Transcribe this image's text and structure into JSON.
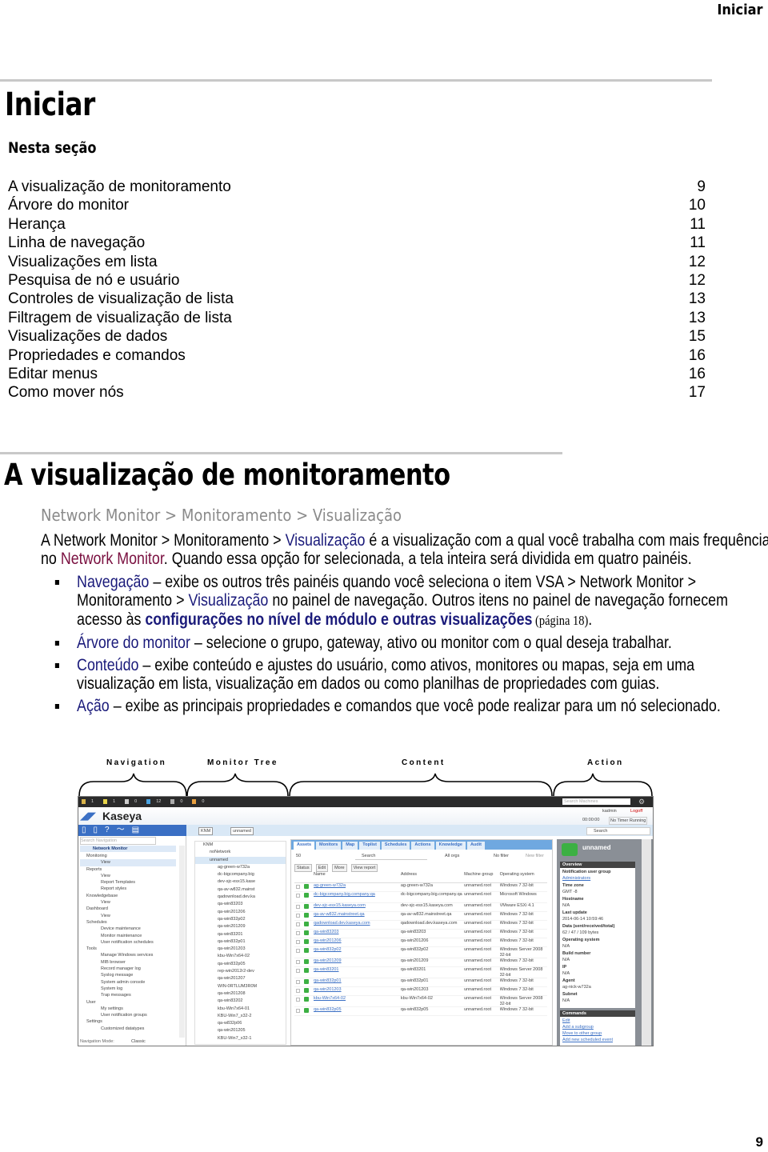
{
  "header": {
    "running_title": "Iniciar"
  },
  "title": "Iniciar",
  "section_heading": "Nesta seção",
  "toc": [
    {
      "label": "A visualização de monitoramento",
      "page": "9"
    },
    {
      "label": "Árvore do monitor",
      "page": "10"
    },
    {
      "label": "Herança",
      "page": "11"
    },
    {
      "label": "Linha de navegação",
      "page": "11"
    },
    {
      "label": "Visualizações em lista",
      "page": "12"
    },
    {
      "label": "Pesquisa de nó e usuário",
      "page": "12"
    },
    {
      "label": "Controles de visualização de lista",
      "page": "13"
    },
    {
      "label": "Filtragem de visualização de lista",
      "page": "13"
    },
    {
      "label": "Visualizações de dados",
      "page": "15"
    },
    {
      "label": "Propriedades e comandos",
      "page": "16"
    },
    {
      "label": "Editar menus",
      "page": "16"
    },
    {
      "label": "Como mover nós",
      "page": "17"
    }
  ],
  "section2": {
    "title": "A visualização de monitoramento",
    "breadcrumb": "Network Monitor  >  Monitoramento  >  Visualização",
    "intro": {
      "p1": "A Network Monitor > Monitoramento > ",
      "link1": "Visualização",
      "p2": " é a visualização com a qual você trabalha com mais frequência no ",
      "link2": "Network Monitor",
      "p3": ". Quando essa opção for selecionada, a tela inteira será dividida em quatro painéis."
    },
    "bullets": [
      {
        "term": "Navegação",
        "a": " – exibe os outros três painéis quando você seleciona o item VSA > Network Monitor > Monitoramento > ",
        "link": "Visualização",
        "b": " no painel de navegação.   Outros itens no painel de navegação fornecem acesso às ",
        "link2": "configurações no nível de módulo e outras visualizações",
        "ref": " (página 18)",
        "end": "."
      },
      {
        "term": "Árvore do monitor",
        "a": " – selecione o grupo, gateway, ativo ou monitor com o qual deseja trabalhar."
      },
      {
        "term": "Conteúdo",
        "a": " – exibe conteúdo e ajustes do usuário, como ativos, monitores ou mapas, seja em uma visualização em lista, visualização em dados ou como planilhas de propriedades com guias."
      },
      {
        "term": "Ação",
        "a": " – exibe as principais propriedades e comandos que você pode realizar para um nó selecionado."
      }
    ]
  },
  "figure": {
    "panel_labels": [
      "Navigation",
      "Monitor Tree",
      "Content",
      "Action"
    ],
    "topbar_counts": [
      "1",
      "1",
      "0",
      "12",
      "0",
      "0"
    ],
    "search_machines": "Search Machines",
    "brand": "Kaseya",
    "user": "kadmin",
    "logoff": "Logoff",
    "timer": "00:00:00",
    "timer_status": "No Timer Running",
    "search_nav": "Search Navigation",
    "nav_module": "Network Monitor",
    "nav_items": [
      "Monitoring",
      "View",
      "Reports",
      "View",
      "Report Templates",
      "Report styles",
      "Knowledgebase",
      "View",
      "Dashboard",
      "View",
      "Schedules",
      "Device maintenance",
      "Monitor maintenance",
      "User notification schedules",
      "Tools",
      "Manage Windows services",
      "MIB browser",
      "Record manager log",
      "Syslog message",
      "System admin console",
      "System log",
      "Trap messages",
      "User",
      "My settings",
      "User notification groups",
      "Settings",
      "Customized datatypes"
    ],
    "nav_mode_label": "Navigation Mode:",
    "nav_mode": "Classic",
    "breadcrumb": [
      "KNM",
      "unnamed"
    ],
    "search": "Search",
    "tree": [
      "KNM",
      "noNetwork",
      "unnamed",
      "ag-green-w732a",
      "dc-bigcompany.big",
      "dev-sjc-esx15.kase",
      "qa-av-w832.mainst",
      "qadownload.dev.ka",
      "qa-win83203",
      "qa-win201206",
      "qa-win832p02",
      "qa-win201209",
      "qa-win83201",
      "qa-win832p01",
      "qa-win201203",
      "kbu-Win7x64-02",
      "qa-win832p05",
      "rep-win2012r2-dev",
      "qa-win201207",
      "WIN-0RTLUM3R0M",
      "qa-win201208",
      "qa-win83202",
      "kbu-Win7x64-01",
      "KBU-Win7_x32-2",
      "qa-w832p06",
      "qa-win201205",
      "KBU-Win7_x32-1"
    ],
    "tabs": [
      "Assets",
      "Monitors",
      "Map",
      "Toplist",
      "Schedules",
      "Actions",
      "Knowledge",
      "Audit"
    ],
    "page_size": "50",
    "org_filter": "All orgs",
    "filter": "No filter",
    "new_filter": "New filter",
    "buttons": [
      "Status",
      "Edit",
      "More",
      "View report"
    ],
    "columns": [
      "Name",
      "Address",
      "Machine group",
      "Operating system"
    ],
    "rows": [
      [
        "ag-green-w732a",
        "ag-green-w732a",
        "unnamed.root",
        "Windows 7 32-bit"
      ],
      [
        "dc-bigcompany.big.company.qa",
        "dc-bigcompany.big.company.qa",
        "unnamed.root",
        "Microsoft Windows"
      ],
      [
        "dev-sjc-esx15.kaseya.com",
        "dev-sjc-esx15.kaseya.com",
        "unnamed.root",
        "VMware ESXi 4.1"
      ],
      [
        "qa-av-w832.mainstreet.qa",
        "qa-av-w832.mainstreet.qa",
        "unnamed.root",
        "Windows 7 32-bit"
      ],
      [
        "qadownload.dev.kaseya.com",
        "qadownload.dev.kaseya.com",
        "unnamed.root",
        "Windows 7 32-bit"
      ],
      [
        "qa-win83203",
        "qa-win83203",
        "unnamed.root",
        "Windows 7 32-bit"
      ],
      [
        "qa-win201206",
        "qa-win201206",
        "unnamed.root",
        "Windows 7 32-bit"
      ],
      [
        "qa-win832p02",
        "qa-win832p02",
        "unnamed.root",
        "Windows Server 2008 32-bit"
      ],
      [
        "qa-win201209",
        "qa-win201209",
        "unnamed.root",
        "Windows 7 32-bit"
      ],
      [
        "qa-win83201",
        "qa-win83201",
        "unnamed.root",
        "Windows Server 2008 32-bit"
      ],
      [
        "qa-win832p01",
        "qa-win832p01",
        "unnamed.root",
        "Windows 7 32-bit"
      ],
      [
        "qa-win201203",
        "qa-win201203",
        "unnamed.root",
        "Windows 7 32-bit"
      ],
      [
        "kbu-Win7x64-02",
        "kbu-Win7x64-02",
        "unnamed.root",
        "Windows Server 2008 32-bit"
      ],
      [
        "qa-win832p05",
        "qa-win832p05",
        "unnamed.root",
        "Windows 7 32-bit"
      ]
    ],
    "action_title": "unnamed",
    "overview_label": "Overview",
    "properties": [
      {
        "k": "Notification user group",
        "v": "Administrators"
      },
      {
        "k": "Time zone",
        "v": "GMT -8"
      },
      {
        "k": "Hostname",
        "v": "N/A"
      },
      {
        "k": "Last update",
        "v": "2014-06-14 10:59:46"
      },
      {
        "k": "Data (sent/received/total)",
        "v": "62 / 47 / 109 bytes"
      },
      {
        "k": "Operating system",
        "v": "N/A"
      },
      {
        "k": "Build number",
        "v": "N/A"
      },
      {
        "k": "IP",
        "v": "N/A"
      },
      {
        "k": "Agent",
        "v": "ag-nick-w732a"
      },
      {
        "k": "Subnet",
        "v": "N/A"
      }
    ],
    "commands_label": "Commands",
    "commands": [
      "Edit",
      "Add a subgroup",
      "Move to other group",
      "Add new scheduled event"
    ]
  },
  "page_number": "9",
  "colors": {
    "link_blue": "#1a1a7a",
    "link_maroon": "#7a1040",
    "rule": "#c8c8c8",
    "kaseya_blue": "#3a6fc4"
  }
}
